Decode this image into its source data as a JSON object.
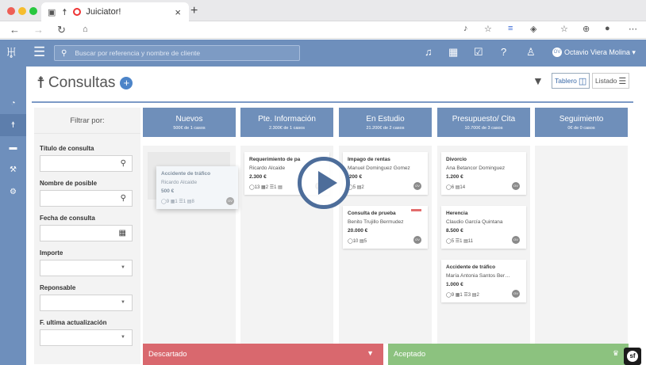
{
  "browser": {
    "tab_title": "Juiciator!",
    "tab_close": "×",
    "new_tab": "+",
    "traffic_colors": [
      "#ee5f56",
      "#f6bd2e",
      "#29c840"
    ]
  },
  "header": {
    "search_placeholder": "Buscar por referencia y nombre de cliente",
    "user_initials": "OV",
    "user_name": "Octavio Viera Molina ▾",
    "bar_color": "#6e8fbc"
  },
  "page": {
    "title": "Consultas",
    "views": {
      "board": "Tablero",
      "list": "Listado"
    }
  },
  "filters": {
    "heading": "Filtrar por:",
    "fields": [
      {
        "label": "Título de consulta",
        "kind": "search"
      },
      {
        "label": "Nombre de posible",
        "kind": "search"
      },
      {
        "label": "Fecha de consulta",
        "kind": "date"
      },
      {
        "label": "Importe",
        "kind": "select"
      },
      {
        "label": "Reponsable",
        "kind": "select"
      },
      {
        "label": "F. ultima actualización",
        "kind": "select"
      }
    ]
  },
  "columns": [
    {
      "name": "Nuevos",
      "summary": "500€ de 1 casos"
    },
    {
      "name": "Pte. Información",
      "summary": "2.300€ de 1 casos"
    },
    {
      "name": "En Estudio",
      "summary": "21.200€ de 2 casos"
    },
    {
      "name": "Presupuesto/ Cita",
      "summary": "10.700€ de 3 casos"
    },
    {
      "name": "Seguimiento",
      "summary": "0€ de 0 casos"
    }
  ],
  "cards": {
    "dragging": {
      "title": "Accidente de tráfico",
      "client": "Ricardo Alcaide",
      "amount": "500 €",
      "meta": "◯9 ▦1 ☰1 ▤8",
      "avatar": "OV"
    },
    "pte": [
      {
        "title": "Requerimiento de pa",
        "client": "Ricardo Alcaide",
        "amount": "2.300 €",
        "meta": "◯13 ▦2 ☰1 ▤",
        "avatar": "OV"
      }
    ],
    "estudio": [
      {
        "title": "Impago de rentas",
        "client": "Manuel Dominguez Gomez",
        "amount": ".200 €",
        "meta": "◯5 ▤2",
        "avatar": "OV"
      },
      {
        "title": "Consulta de prueba",
        "client": "Benito Trujillo Bermudez",
        "amount": "20.000 €",
        "meta": "◯10 ▤5",
        "avatar": "OV"
      }
    ],
    "presupuesto": [
      {
        "title": "Divorcio",
        "client": "Ana Betancor Dominguez",
        "amount": "1.200 €",
        "meta": "◯6 ▤14",
        "avatar": "OV"
      },
      {
        "title": "Herencia",
        "client": "Claudio García Quintana",
        "amount": "8.500 €",
        "meta": "◯5 ☰1 ▤11",
        "avatar": "OV"
      },
      {
        "title": "Accidente de tráfico",
        "client": "María Antonia Santos Ber…",
        "amount": "1.000 €",
        "meta": "◯9 ▦1 ☰3 ▤2",
        "avatar": "OV"
      }
    ]
  },
  "drop_zones": {
    "discarded": {
      "label": "Descartado",
      "color": "#d9686e"
    },
    "accepted": {
      "label": "Aceptado",
      "color": "#8cc27f"
    }
  },
  "badge": {
    "symbol": "sf"
  }
}
